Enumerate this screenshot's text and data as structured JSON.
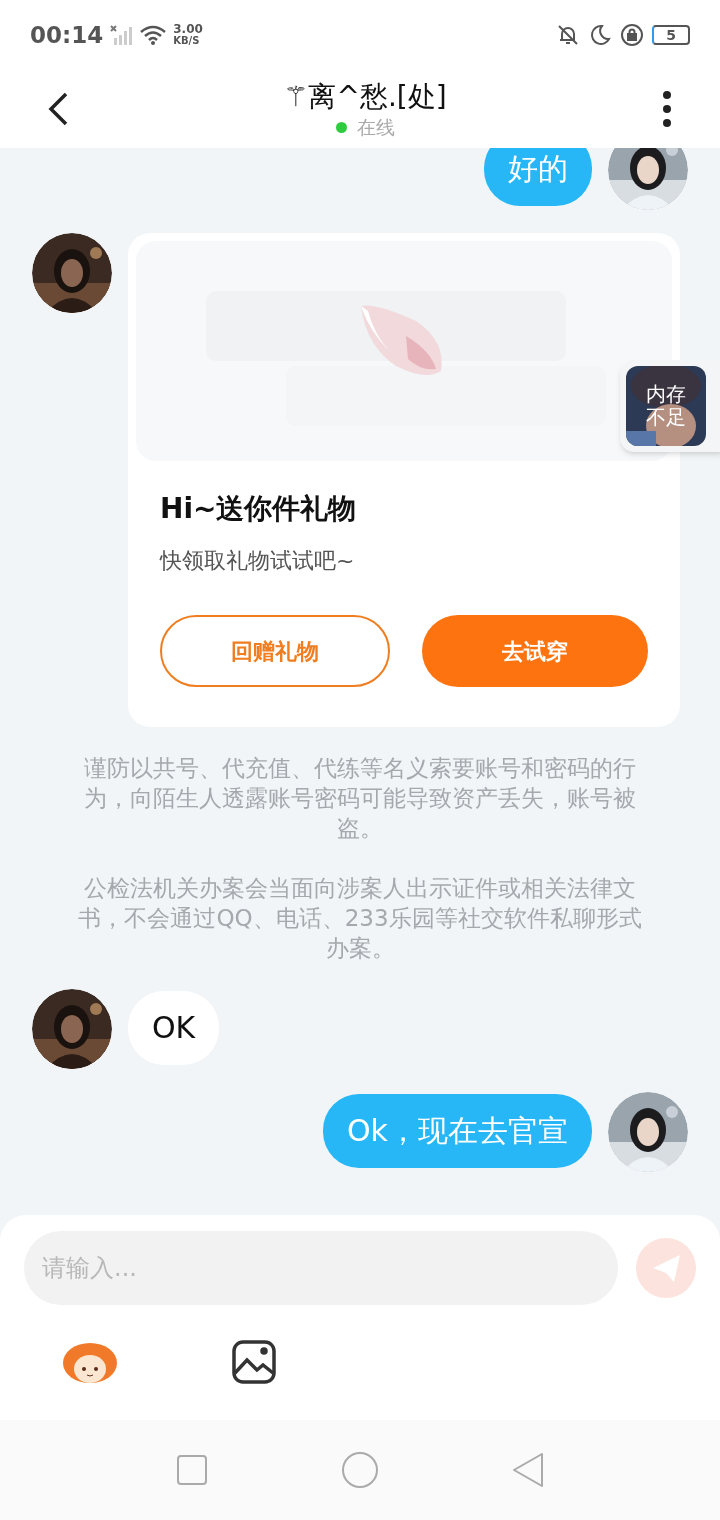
{
  "status_bar": {
    "time": "00:14",
    "speed_value": "3.00",
    "speed_unit": "KB/S",
    "battery": "5"
  },
  "header": {
    "title": "⚚离^愁.[处]",
    "status": "在线",
    "online": true
  },
  "messages": [
    {
      "kind": "text",
      "mine": true,
      "text": "好的"
    },
    {
      "kind": "gift",
      "mine": false,
      "title": "Hi~送你件礼物",
      "subtitle": "快领取礼物试试吧~",
      "buttons": [
        {
          "label": "回赠礼物",
          "primary": false
        },
        {
          "label": "去试穿",
          "primary": true
        }
      ]
    },
    {
      "kind": "notice",
      "paragraphs": [
        "谨防以共号、代充值、代练等名义索要账号和密码的行为，向陌生人透露账号密码可能导致资产丢失，账号被盗。",
        "公检法机关办案会当面向涉案人出示证件或相关法律文书，不会通过QQ、电话、233乐园等社交软件私聊形式办案。"
      ]
    },
    {
      "kind": "text",
      "mine": false,
      "text": "OK"
    },
    {
      "kind": "text",
      "mine": true,
      "text": "Ok，现在去官宣"
    }
  ],
  "floating_badge": {
    "text": "内存不足"
  },
  "composer": {
    "placeholder": "请输入..."
  }
}
